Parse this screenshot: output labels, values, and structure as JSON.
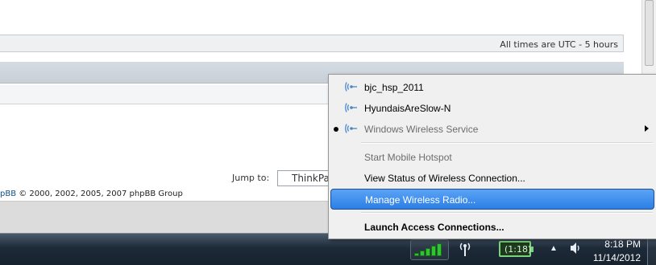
{
  "forum": {
    "times_text": "All times are UTC - 5 hours",
    "jump_label": "Jump to:",
    "jump_value": "ThinkPad",
    "copyright_link": "pBB",
    "copyright_rest": " © 2000, 2002, 2005, 2007 phpBB Group"
  },
  "menu": {
    "networks": [
      {
        "label": "bjc_hsp_2011",
        "connected": false,
        "disabled": false
      },
      {
        "label": "HyundaisAreSlow-N",
        "connected": false,
        "disabled": false
      },
      {
        "label": "Windows Wireless Service",
        "connected": true,
        "disabled": true
      }
    ],
    "actions": [
      {
        "label": "Start Mobile Hotspot",
        "disabled": true
      },
      {
        "label": "View Status of Wireless Connection...",
        "disabled": false
      },
      {
        "label": "Manage Wireless Radio...",
        "highlighted": true
      }
    ],
    "launch_label": "Launch Access Connections..."
  },
  "taskbar": {
    "battery_text": "(1:18)",
    "time": "8:18 PM",
    "date": "11/14/2012"
  },
  "icons": {
    "wireless": "wireless-icon",
    "signal": "signal-strength-icon",
    "network_tray": "network-tray-icon",
    "battery": "battery-icon",
    "show_hidden": "chevron-up-icon",
    "volume": "volume-icon"
  },
  "colors": {
    "highlight": "#2d7fe6",
    "signal_green": "#2ec52e",
    "link": "#105289"
  }
}
